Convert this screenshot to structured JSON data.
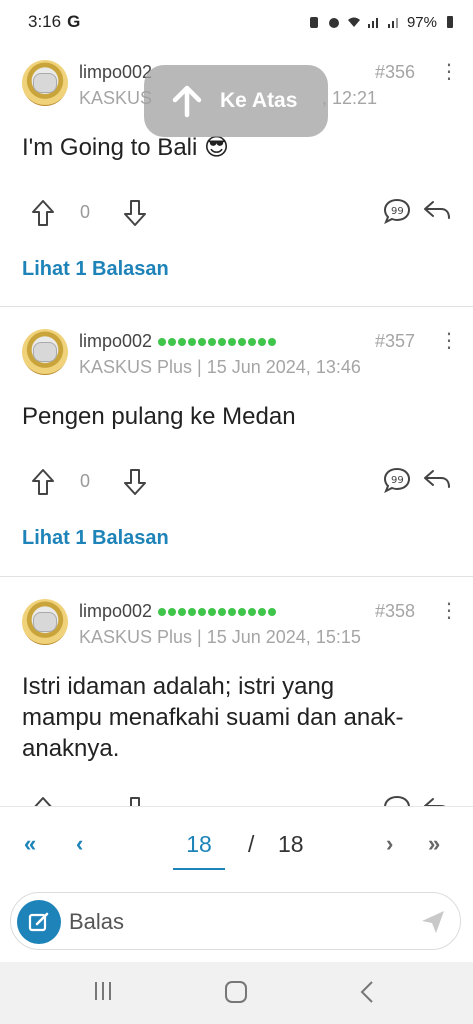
{
  "status_bar": {
    "time": "3:16",
    "carrier_glyph": "G",
    "battery": "97%"
  },
  "scroll_top": {
    "label": "Ke Atas"
  },
  "posts": [
    {
      "username": "limpo002",
      "role": "KASKUS",
      "time_visible": ", 12:21",
      "number": "#356",
      "text": "I'm Going to Bali 😎",
      "votes": "0",
      "replies_link": "Lihat 1 Balasan"
    },
    {
      "username": "limpo002",
      "role": "KASKUS Plus | 15 Jun 2024, 13:46",
      "number": "#357",
      "text": "Pengen pulang ke Medan",
      "votes": "0",
      "replies_link": "Lihat 1 Balasan"
    },
    {
      "username": "limpo002",
      "role": "KASKUS Plus | 15 Jun 2024, 15:15",
      "number": "#358",
      "text": "Istri idaman adalah; istri yang mampu menafkahi suami dan anak-anaknya."
    }
  ],
  "pager": {
    "current": "18",
    "separator": "/",
    "total": "18"
  },
  "compose": {
    "placeholder": "Balas"
  },
  "colors": {
    "accent": "#1d83b8",
    "reputation": "#3ec54a",
    "muted": "#a5a5a5"
  }
}
